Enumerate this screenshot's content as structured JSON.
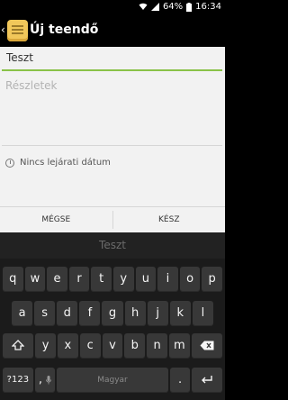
{
  "status_bar": {
    "battery": "64%",
    "time": "16:34"
  },
  "action_bar": {
    "back_icon": "chevron-left",
    "app_icon": "note-icon",
    "title": "Új teendő"
  },
  "form": {
    "title_value": "Teszt",
    "details_placeholder": "Részletek",
    "due_text": "Nincs lejárati dátum"
  },
  "buttons": {
    "cancel": "MÉGSE",
    "done": "KÉSZ"
  },
  "keyboard": {
    "suggestion": "Teszt",
    "row1": [
      "q",
      "w",
      "e",
      "r",
      "t",
      "y",
      "u",
      "i",
      "o",
      "p"
    ],
    "row2": [
      "a",
      "s",
      "d",
      "f",
      "g",
      "h",
      "j",
      "k",
      "l"
    ],
    "row3": [
      "y",
      "x",
      "c",
      "v",
      "b",
      "n",
      "m"
    ],
    "row4_left": "?123",
    "row4_comma": ",",
    "row4_space": "Magyar",
    "row4_period": "."
  }
}
